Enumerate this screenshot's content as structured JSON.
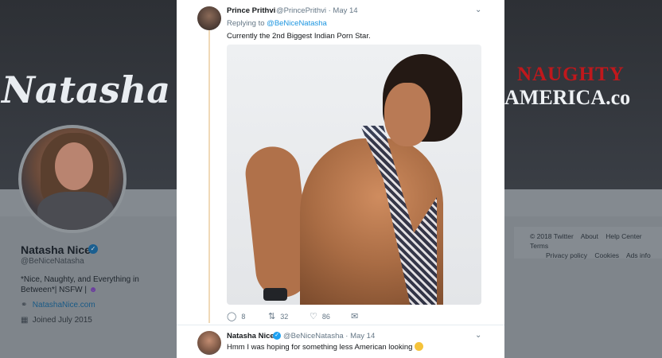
{
  "background": {
    "banner_left_text": "Natasha Ni",
    "banner_brand_line1": "NAUGHTY",
    "banner_brand_line2": "AMERICA.co",
    "profile": {
      "name": "Natasha Nice",
      "handle": "@BeNiceNatasha",
      "bio": "*Nice, Naughty, and Everything in Between*| NSFW |",
      "link": "NatashaNice.com",
      "joined": "Joined July 2015"
    },
    "footer": {
      "items": [
        "© 2018 Twitter",
        "About",
        "Help Center",
        "Terms",
        "Privacy policy",
        "Cookies",
        "Ads info"
      ]
    }
  },
  "tweet": {
    "author_name": "Prince Prithvi",
    "handle_time": "@PrincePrithvi · May 14",
    "replying_label": "Replying to",
    "replying_mention": "@BeNiceNatasha",
    "text": "Currently the 2nd Biggest Indian Porn Star.",
    "actions": {
      "replies": "8",
      "retweets": "32",
      "likes": "86"
    }
  },
  "reply": {
    "author_name": "Natasha Nice",
    "handle_time": "@BeNiceNatasha · May 14",
    "text": "Hmm I was hoping for something less American looking"
  },
  "icons": {
    "caret": "chevron-down",
    "reply": "speech-bubble",
    "retweet": "retweet-arrows",
    "like": "heart",
    "dm": "envelope",
    "verified": "check-badge",
    "link": "link",
    "calendar": "calendar"
  },
  "colors": {
    "accent": "#1b95e0",
    "verified": "#1da1f2",
    "thread_line": "#f0d9b8"
  }
}
